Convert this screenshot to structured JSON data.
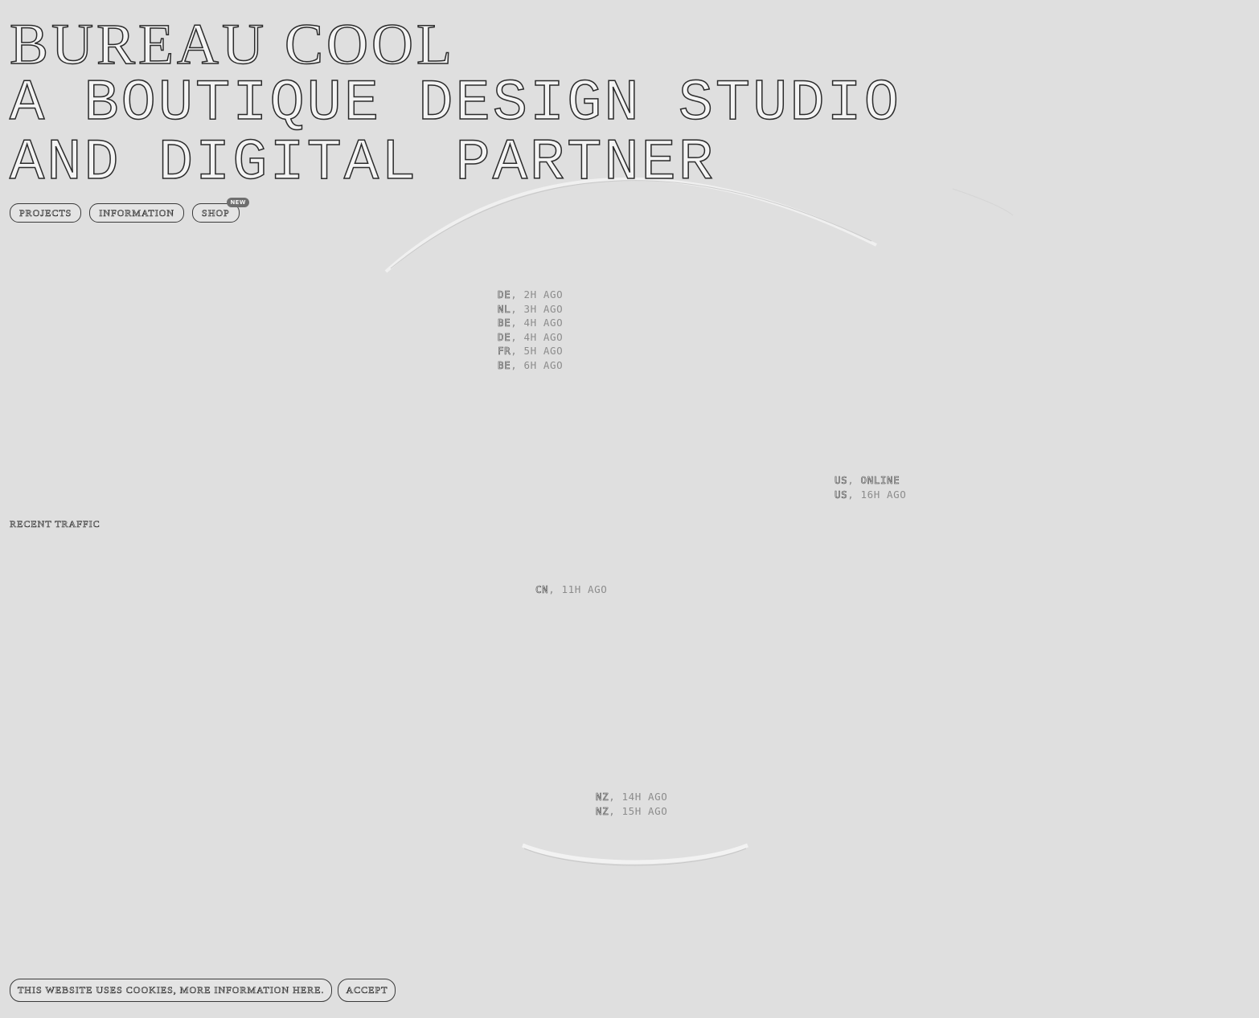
{
  "hero": {
    "brand": "BUREAU COOL",
    "tagline_line1": "A BOUTIQUE DESIGN STUDIO",
    "tagline_line2": "AND DIGITAL PARTNER"
  },
  "nav": {
    "projects": "PROJECTS",
    "information": "INFORMATION",
    "shop": "SHOP",
    "shop_badge": "NEW"
  },
  "traffic": {
    "label": "RECENT TRAFFIC",
    "groups": [
      {
        "visits": [
          {
            "country": "DE",
            "ago": "2H AGO"
          },
          {
            "country": "NL",
            "ago": "3H AGO"
          },
          {
            "country": "BE",
            "ago": "4H AGO"
          },
          {
            "country": "DE",
            "ago": "4H AGO"
          },
          {
            "country": "FR",
            "ago": "5H AGO"
          },
          {
            "country": "BE",
            "ago": "6H AGO"
          }
        ]
      },
      {
        "visits": [
          {
            "country": "US",
            "ago": "ONLINE"
          },
          {
            "country": "US",
            "ago": "16H AGO"
          }
        ]
      },
      {
        "visits": [
          {
            "country": "CN",
            "ago": "11H AGO"
          }
        ]
      },
      {
        "visits": [
          {
            "country": "NZ",
            "ago": "14H AGO"
          },
          {
            "country": "NZ",
            "ago": "15H AGO"
          }
        ]
      }
    ]
  },
  "cookie": {
    "message": "THIS WEBSITE USES COOKIES, MORE INFORMATION HERE.",
    "accept": "ACCEPT"
  },
  "colors": {
    "background": "#dfdfdf",
    "outline_text": "#2b2b2b",
    "muted_text": "#8a8a8a",
    "badge": "#6e6e6e"
  }
}
